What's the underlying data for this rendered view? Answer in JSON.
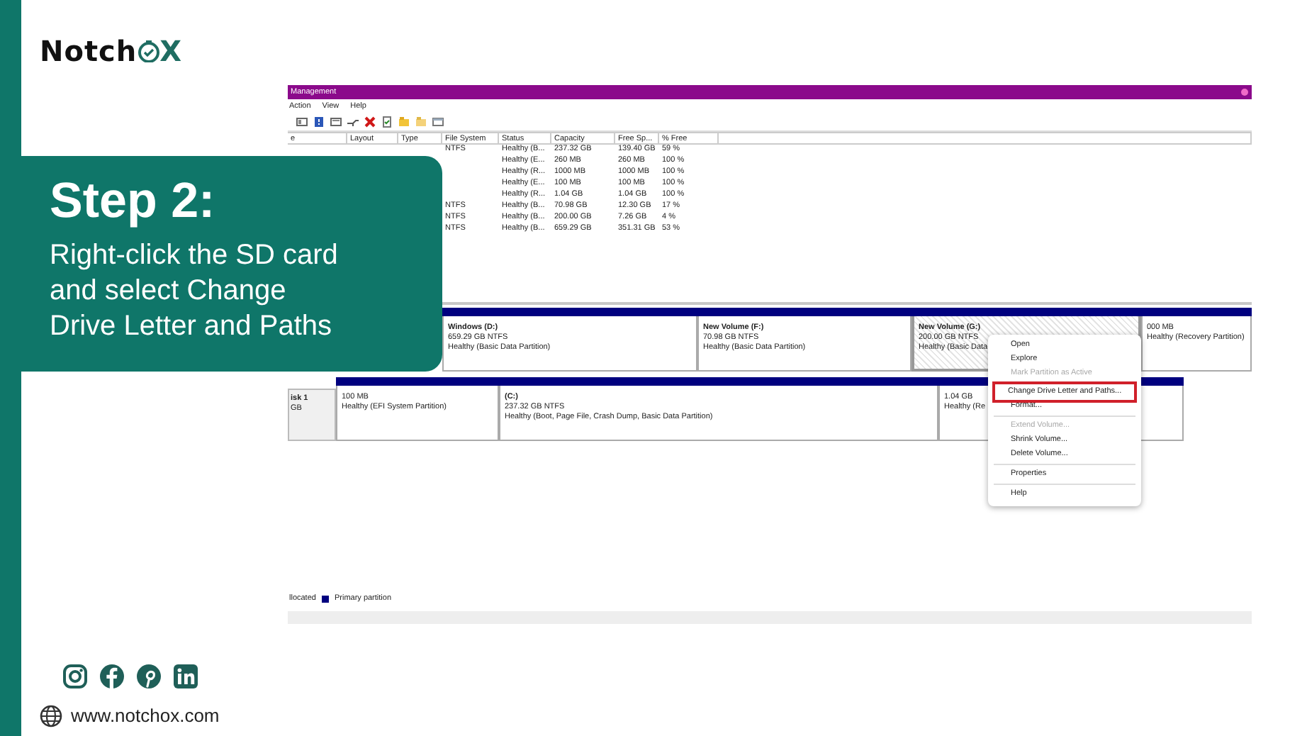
{
  "brand": {
    "name_start": "Notch",
    "name_end": "X"
  },
  "step_card": {
    "title": "Step 2:",
    "lines": [
      "Right-click the SD card",
      "and select Change",
      "Drive Letter and Paths"
    ]
  },
  "window": {
    "title": "Management",
    "menu": [
      "Action",
      "View",
      "Help"
    ]
  },
  "volume_list": {
    "columns": [
      "e",
      "Layout",
      "Type",
      "File System",
      "Status",
      "Capacity",
      "Free Sp...",
      "% Free"
    ],
    "rows": [
      {
        "file_system": "NTFS",
        "status": "Healthy (B...",
        "capacity": "237.32 GB",
        "free_space": "139.40 GB",
        "percent_free": "59 %"
      },
      {
        "status": "Healthy (E...",
        "capacity": "260 MB",
        "free_space": "260 MB",
        "percent_free": "100 %"
      },
      {
        "status": "Healthy (R...",
        "capacity": "1000 MB",
        "free_space": "1000 MB",
        "percent_free": "100 %"
      },
      {
        "status": "Healthy (E...",
        "capacity": "100 MB",
        "free_space": "100 MB",
        "percent_free": "100 %"
      },
      {
        "status": "Healthy (R...",
        "capacity": "1.04 GB",
        "free_space": "1.04 GB",
        "percent_free": "100 %"
      },
      {
        "file_system": "NTFS",
        "status": "Healthy (B...",
        "capacity": "70.98 GB",
        "free_space": "12.30 GB",
        "percent_free": "17 %"
      },
      {
        "file_system": "NTFS",
        "status": "Healthy (B...",
        "capacity": "200.00 GB",
        "free_space": "7.26 GB",
        "percent_free": "4 %"
      },
      {
        "file_system": "NTFS",
        "status": "Healthy (B...",
        "capacity": "659.29 GB",
        "free_space": "351.31 GB",
        "percent_free": "53 %"
      }
    ]
  },
  "disks": [
    {
      "partitions": [
        {
          "name": "Windows  (D:)",
          "size": "659.29 GB NTFS",
          "status": "Healthy (Basic Data Partition)",
          "selected": false
        },
        {
          "name": "New Volume  (F:)",
          "size": "70.98 GB NTFS",
          "status": "Healthy (Basic Data Partition)",
          "selected": false
        },
        {
          "name": "New Volume  (G:)",
          "size": "200.00 GB NTFS",
          "status": "Healthy (Basic Data",
          "selected": true
        },
        {
          "size": "000 MB",
          "status": "Healthy (Recovery Partition)",
          "selected": false
        }
      ]
    },
    {
      "label": [
        "isk 1",
        "GB"
      ],
      "partitions": [
        {
          "size": "100 MB",
          "status": "Healthy (EFI System Partition)",
          "selected": false
        },
        {
          "name": "(C:)",
          "size": "237.32 GB NTFS",
          "status": "Healthy (Boot, Page File, Crash Dump, Basic Data Partition)",
          "selected": false
        },
        {
          "size": "1.04 GB",
          "status": "Healthy (Re",
          "selected": false
        }
      ]
    }
  ],
  "legend": {
    "unallocated": "llocated",
    "primary": "Primary partition"
  },
  "context_menu": {
    "items": [
      {
        "kind": "item",
        "label": "Open",
        "disabled": false,
        "selected": false
      },
      {
        "kind": "item",
        "label": "Explore",
        "disabled": false,
        "selected": false
      },
      {
        "kind": "item",
        "label": "Mark Partition as Active",
        "disabled": true,
        "selected": false
      },
      {
        "kind": "item",
        "label": "Change Drive Letter and Paths...",
        "disabled": false,
        "selected": true
      },
      {
        "kind": "item",
        "label": "Format...",
        "disabled": false,
        "selected": false
      },
      {
        "kind": "separator"
      },
      {
        "kind": "item",
        "label": "Extend Volume...",
        "disabled": true,
        "selected": false
      },
      {
        "kind": "item",
        "label": "Shrink Volume...",
        "disabled": false,
        "selected": false
      },
      {
        "kind": "item",
        "label": "Delete Volume...",
        "disabled": false,
        "selected": false
      },
      {
        "kind": "separator"
      },
      {
        "kind": "item",
        "label": "Properties",
        "disabled": false,
        "selected": false
      },
      {
        "kind": "separator"
      },
      {
        "kind": "item",
        "label": "Help",
        "disabled": false,
        "selected": false
      }
    ]
  },
  "footer": {
    "website": "www.notchox.com"
  }
}
